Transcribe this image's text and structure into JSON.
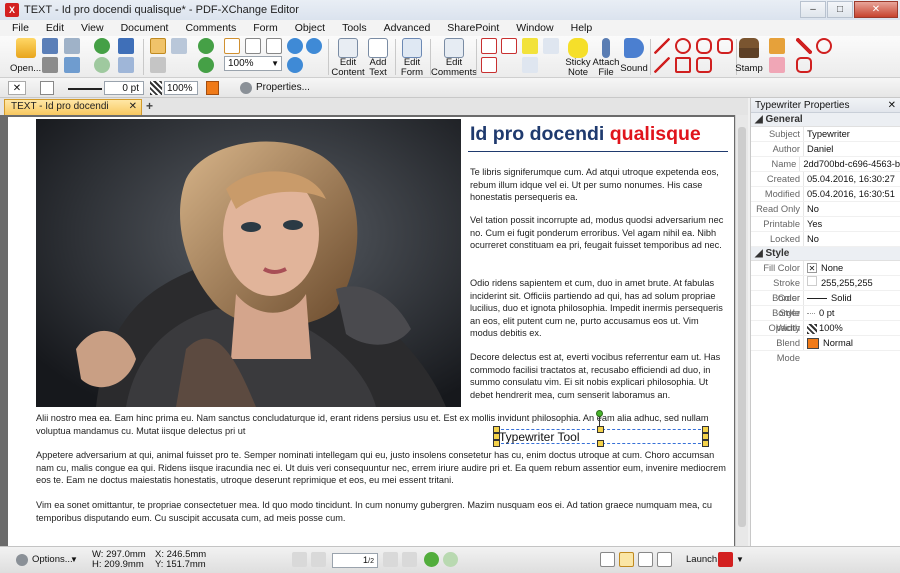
{
  "window": {
    "title": "TEXT - Id pro docendi qualisque* - PDF-XChange Editor",
    "controls": [
      "–",
      "□",
      "✕"
    ]
  },
  "menu": [
    "File",
    "Edit",
    "View",
    "Document",
    "Comments",
    "Form",
    "Object",
    "Tools",
    "Advanced",
    "SharePoint",
    "Window",
    "Help"
  ],
  "toolbar": {
    "open": "Open...",
    "zoom": "100%",
    "edit_content": [
      "Edit",
      "Content"
    ],
    "add_text": [
      "Add",
      "Text"
    ],
    "edit_form": [
      "Edit",
      "Form"
    ],
    "edit_comments": [
      "Edit",
      "Comments"
    ],
    "sticky_note": [
      "Sticky",
      "Note"
    ],
    "attach_file": [
      "Attach",
      "File"
    ],
    "sound": "Sound",
    "stamp": "Stamp"
  },
  "propbar": {
    "stroke_width": "0 pt",
    "opacity": "100%",
    "properties": "Properties..."
  },
  "tab": {
    "label": "TEXT - Id pro docendi qualisque *",
    "close": "✕",
    "new": "+"
  },
  "document": {
    "heading_part1": "Id pro docendi ",
    "heading_part2": "qualisque",
    "para1": "Te libris signiferumque cum. Ad atqui utroque expetenda eos, rebum illum idque vel ei. Ut per sumo nonumes. His case honestatis persequeris ea.",
    "para2": "Vel tation possit incorrupte ad, modus quodsi adversarium nec no. Cum ei fugit ponderum erroribus. Vel agam nihil ea. Nibh ocurreret constituam ea pri, feugait fuisset temporibus ad nec.",
    "para3": "Odio ridens sapientem et cum, duo in amet brute. At fabulas inciderint sit. Officiis partiendo ad qui, has ad solum propriae lucilius, duo et ignota philosophia. Impedit inermis persequeris an eos, elit putent cum ne, purto accusamus eos ut. Vim modus debitis ex.",
    "para4": "Decore delectus est at, everti vocibus referrentur eam ut. Has commodo facilisi tractatos at, recusabo efficiendi ad duo, in summo consulatu vim. Ei sit nobis explicari philosophia. Ut debet hendrerit mea, cum senserit laboramus an.",
    "para5_line1": "Alii nostro mea ea. Eam hinc prima eu. Nam sanctus concludaturque id, erant ridens persius usu et. Est ex mollis invidunt philosophia. An eam alia adhuc, sed nullam",
    "para5_line2": "voluptua mandamus cu. Mutat iisque delectus pri ut",
    "para6": "Appetere adversarium at qui, animal fuisset pro te. Semper nominati intellegam qui eu, justo insolens consetetur has cu, enim doctus utroque at cum. Choro accumsan nam cu, malis congue ea qui. Ridens iisque iracundia nec ei. Ut duis veri consequuntur nec, errem iriure audire pri et. Ea quem rebum assentior eum, invenire mediocrem eos te. Eam ne doctus maiestatis honestatis, utroque deserunt reprimique et eos, eu mei essent tritani.",
    "para7": "Vim ea sonet omittantur, te propriae consectetuer mea. Id quo modo tincidunt. In cum nonumy gubergren. Mazim nusquam eos ei. Ad tation graece numquam mea, cu temporibus disputando eum. Cu suscipit accusata cum, ad meis posse cum.",
    "typewriter": "Typewriter Tool"
  },
  "panel": {
    "title": "Typewriter Properties",
    "close": "✕",
    "general_label": "General",
    "general": [
      {
        "k": "Subject",
        "v": "Typewriter"
      },
      {
        "k": "Author",
        "v": "Daniel"
      },
      {
        "k": "Name",
        "v": "2dd700bd-c696-4563-b..."
      },
      {
        "k": "Created",
        "v": "05.04.2016, 16:30:27"
      },
      {
        "k": "Modified",
        "v": "05.04.2016, 16:30:51"
      },
      {
        "k": "Read Only",
        "v": "No"
      },
      {
        "k": "Printable",
        "v": "Yes"
      },
      {
        "k": "Locked",
        "v": "No"
      }
    ],
    "style_label": "Style",
    "style": [
      {
        "k": "Fill Color",
        "v": "None"
      },
      {
        "k": "Stroke Color",
        "v": "255,255,255"
      },
      {
        "k": "Border Style",
        "v": "Solid"
      },
      {
        "k": "Border Width",
        "v": "0 pt"
      },
      {
        "k": "Opacity",
        "v": "100%"
      },
      {
        "k": "Blend Mode",
        "v": "Normal"
      }
    ]
  },
  "status": {
    "options": "Options...",
    "w": "W: 297.0mm",
    "h": "H: 209.9mm",
    "x": "X: 246.5mm",
    "y": "Y: 151.7mm",
    "page": "1",
    "page_total": "/2",
    "launch": "Launch:"
  }
}
